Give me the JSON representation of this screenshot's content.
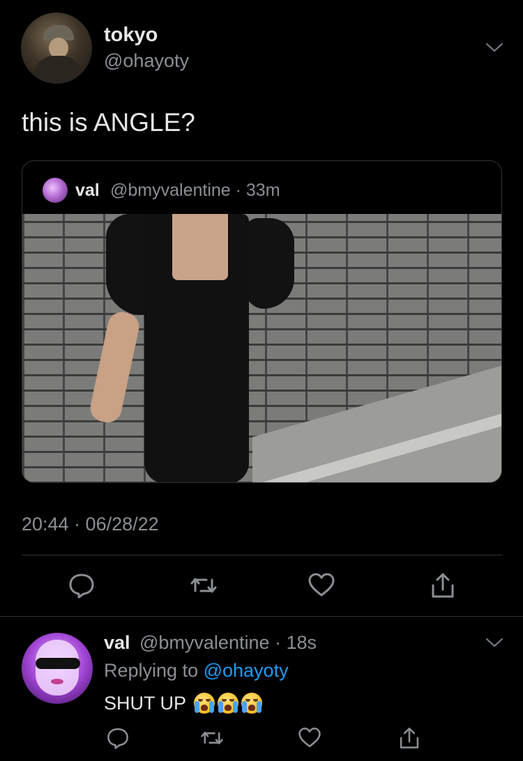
{
  "tweet": {
    "display_name": "tokyo",
    "handle": "@ohayoty",
    "text": "this is ANGLE?",
    "timestamp": "20:44 · 06/28/22"
  },
  "quoted_tweet": {
    "display_name": "val",
    "meta": "@bmyvalentine · 33m"
  },
  "reply": {
    "display_name": "val",
    "meta": "@bmyvalentine · 18s",
    "replying_prefix": "Replying to ",
    "replying_mention": "@ohayoty",
    "text": "SHUT UP",
    "emoji_count": 3
  },
  "icons": [
    "reply-icon",
    "retweet-icon",
    "like-icon",
    "share-icon",
    "chevron-down-icon"
  ],
  "colors": {
    "background": "#000000",
    "text": "#e7e7e7",
    "secondary": "#8b8f94",
    "link": "#1d9bf0",
    "border": "#2f3336"
  }
}
